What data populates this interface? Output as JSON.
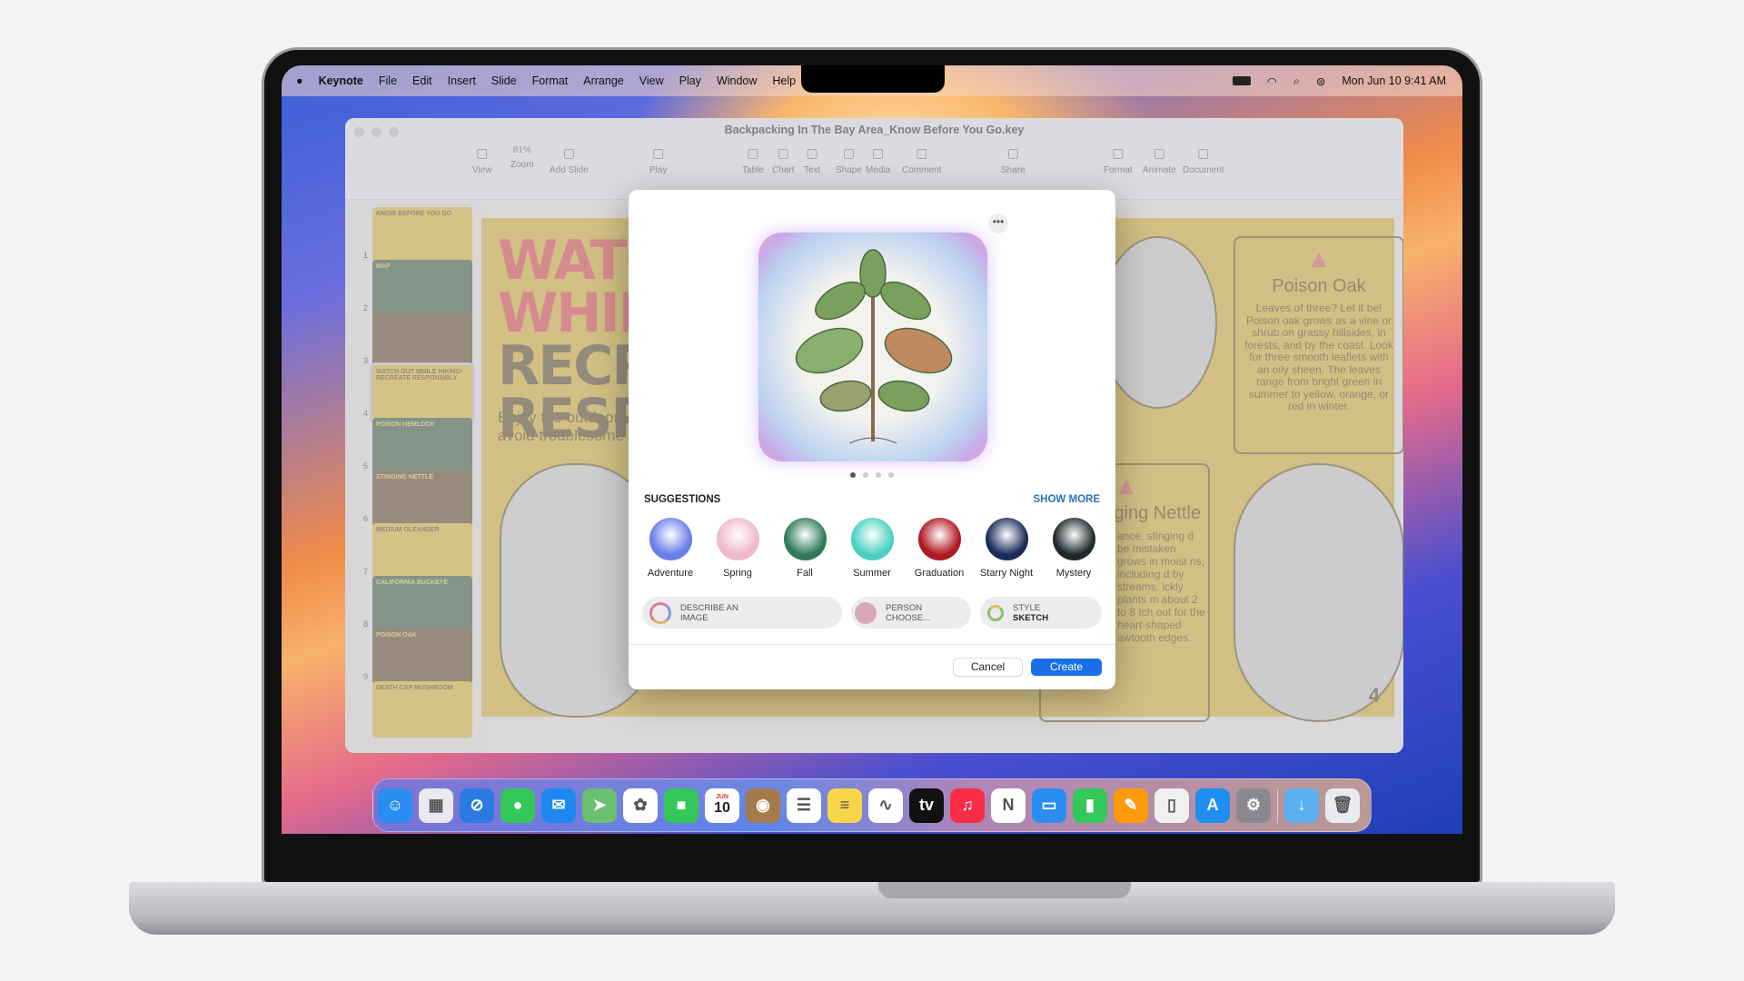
{
  "menubar": {
    "app": "Keynote",
    "items": [
      "File",
      "Edit",
      "Insert",
      "Slide",
      "Format",
      "Arrange",
      "View",
      "Play",
      "Window",
      "Help"
    ],
    "clock": "Mon Jun 10 9:41 AM"
  },
  "window": {
    "title": "Backpacking In The Bay Area_Know Before You Go.key",
    "toolbar": [
      {
        "label": "View",
        "icon": "sidebar-icon"
      },
      {
        "label": "Zoom",
        "value": "81%"
      },
      {
        "label": "Add Slide",
        "icon": "plus-icon"
      },
      {
        "label": "Play",
        "icon": "play-icon"
      },
      {
        "label": "Table"
      },
      {
        "label": "Chart"
      },
      {
        "label": "Text"
      },
      {
        "label": "Shape"
      },
      {
        "label": "Media"
      },
      {
        "label": "Comment"
      },
      {
        "label": "Share"
      },
      {
        "label": "Format"
      },
      {
        "label": "Animate"
      },
      {
        "label": "Document"
      }
    ]
  },
  "slides": [
    {
      "n": "1",
      "title": "KNOW BEFORE YOU GO",
      "color": "#e0c04c"
    },
    {
      "n": "2",
      "title": "MAP",
      "color": "#4e6a50"
    },
    {
      "n": "3",
      "title": "",
      "color": "#6e5a3c"
    },
    {
      "n": "4",
      "title": "WATCH OUT WHILE HIKING! RECREATE RESPONSIBLY",
      "color": "#e0c04c"
    },
    {
      "n": "5",
      "title": "POISON HEMLOCK",
      "color": "#4e6a50"
    },
    {
      "n": "6",
      "title": "STINGING NETTLE",
      "color": "#6e5a3c"
    },
    {
      "n": "7",
      "title": "MEDIUM OLEANDER",
      "color": "#e0c04c"
    },
    {
      "n": "8",
      "title": "CALIFORNIA BUCKEYE",
      "color": "#4e6a50"
    },
    {
      "n": "9",
      "title": "POISON OAK",
      "color": "#6e5a3c"
    },
    {
      "n": "",
      "title": "DEATH CAP MUSHROOM",
      "color": "#e0c04c"
    }
  ],
  "slide": {
    "headline": [
      "WATCH OUT",
      "WHILE HIKING!",
      "RECREATE",
      "RESPONSIBLY"
    ],
    "subtitle": [
      "Enjoy the outdoors safely and",
      "avoid troublesome plants."
    ],
    "poison_oak": {
      "title": "Poison Oak",
      "body": "Leaves of three? Let it be! Poison oak grows as a vine or shrub on grassy hillsides, in forests, and by the coast. Look for three smooth leaflets with an oily sheen. The leaves range from bright green in summer to yellow, orange, or red in winter."
    },
    "nettle": {
      "title": "Stinging Nettle",
      "body": "ance, stinging d be mistaken grows in moist ns, including d by streams. ickly plants m about 2 to 8 tch out for the heart-shaped awtooth edges."
    },
    "page": "4"
  },
  "dialog": {
    "suggestions_label": "SUGGESTIONS",
    "show_more": "SHOW MORE",
    "page_count": 4,
    "current_page": 1,
    "categories": [
      {
        "label": "Adventure",
        "color": "#6a7de8"
      },
      {
        "label": "Spring",
        "color": "#f0b8c8"
      },
      {
        "label": "Fall",
        "color": "#2e7a5a"
      },
      {
        "label": "Summer",
        "color": "#4ad0c0"
      },
      {
        "label": "Graduation",
        "color": "#b01822"
      },
      {
        "label": "Starry Night",
        "color": "#1c2c5a"
      },
      {
        "label": "Mystery",
        "color": "#1e2a2a"
      }
    ],
    "describe": [
      "DESCRIBE AN",
      "IMAGE"
    ],
    "person": [
      "PERSON",
      "CHOOSE..."
    ],
    "style": [
      "STYLE",
      "SKETCH"
    ],
    "cancel": "Cancel",
    "create": "Create",
    "accent": "#1a6fe8"
  },
  "dock": [
    {
      "name": "finder",
      "c": "#2a8ef0",
      "g": "☺"
    },
    {
      "name": "launchpad",
      "c": "#e8e8ee",
      "g": "▦"
    },
    {
      "name": "safari",
      "c": "#2a7ae0",
      "g": "⊘"
    },
    {
      "name": "messages",
      "c": "#34c759",
      "g": "●"
    },
    {
      "name": "mail",
      "c": "#1e88f0",
      "g": "✉"
    },
    {
      "name": "maps",
      "c": "#6ac070",
      "g": "➤"
    },
    {
      "name": "photos",
      "c": "#ffffff",
      "g": "✿"
    },
    {
      "name": "facetime",
      "c": "#34c759",
      "g": "■"
    },
    {
      "name": "calendar",
      "c": "#ffffff",
      "g": "10"
    },
    {
      "name": "contacts",
      "c": "#a57a4a",
      "g": "◉"
    },
    {
      "name": "reminders",
      "c": "#ffffff",
      "g": "☰"
    },
    {
      "name": "notes",
      "c": "#f8d64a",
      "g": "≡"
    },
    {
      "name": "freeform",
      "c": "#ffffff",
      "g": "∿"
    },
    {
      "name": "tv",
      "c": "#111111",
      "g": "tv"
    },
    {
      "name": "music",
      "c": "#fa2d48",
      "g": "♫"
    },
    {
      "name": "news",
      "c": "#ffffff",
      "g": "N"
    },
    {
      "name": "keynote",
      "c": "#2a8ef0",
      "g": "▭"
    },
    {
      "name": "numbers",
      "c": "#34c759",
      "g": "▮"
    },
    {
      "name": "pages",
      "c": "#ff9a0a",
      "g": "✎"
    },
    {
      "name": "iphone-mirroring",
      "c": "#f0f0f0",
      "g": "▯"
    },
    {
      "name": "app-store",
      "c": "#1e8ef0",
      "g": "A"
    },
    {
      "name": "system-settings",
      "c": "#8a8a8e",
      "g": "⚙"
    }
  ],
  "dock_right": [
    {
      "name": "downloads",
      "c": "#5ab0f0",
      "g": "↓"
    },
    {
      "name": "trash",
      "c": "#e8eaee",
      "g": "🗑"
    }
  ],
  "calendar_month": "JUN"
}
